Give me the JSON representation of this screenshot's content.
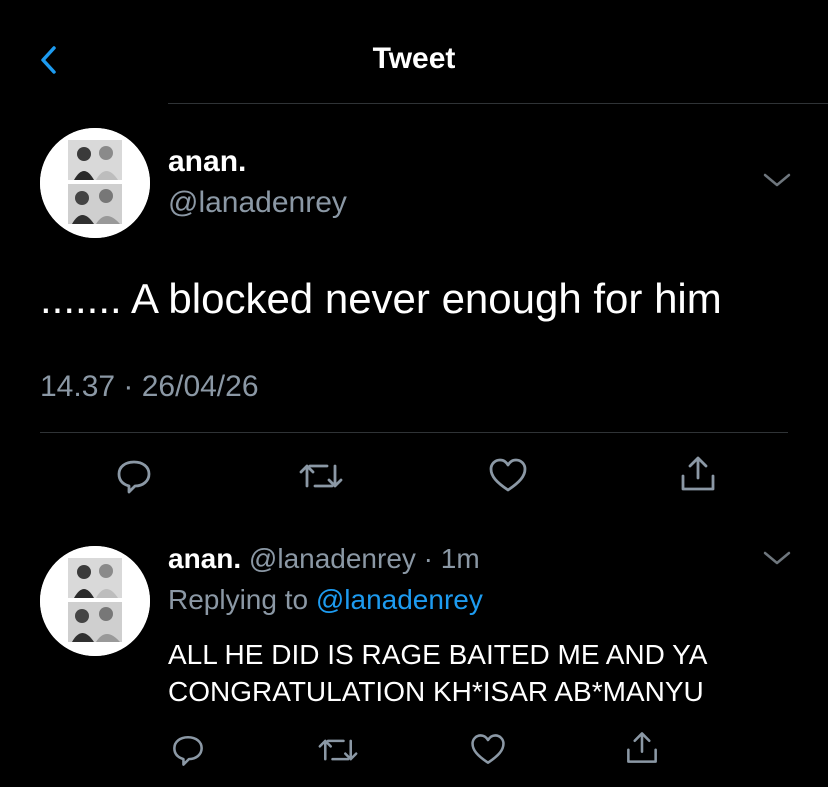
{
  "header": {
    "title": "Tweet",
    "back_icon": "chevron-left-icon"
  },
  "colors": {
    "background": "#000000",
    "accent": "#1d9bf0",
    "muted": "#8b98a5",
    "divider": "#2f3336",
    "text": "#ffffff"
  },
  "tweet": {
    "author": {
      "name": "anan.",
      "handle": "@lanadenrey"
    },
    "text": "....... A blocked never enough for him",
    "timestamp": "14.37 · 26/04/26",
    "actions": [
      "reply-icon",
      "retweet-icon",
      "like-icon",
      "share-icon"
    ]
  },
  "reply": {
    "author": {
      "name": "anan.",
      "handle": "@lanadenrey",
      "time": "1m"
    },
    "meta_separator": " · ",
    "replying_prefix": "Replying to ",
    "replying_to": "@lanadenrey",
    "lines": [
      "ALL HE DID IS RAGE BAITED ME AND YA",
      "CONGRATULATION KH*ISAR AB*MANYU"
    ],
    "actions": [
      "reply-icon",
      "retweet-icon",
      "like-icon",
      "share-icon"
    ]
  }
}
